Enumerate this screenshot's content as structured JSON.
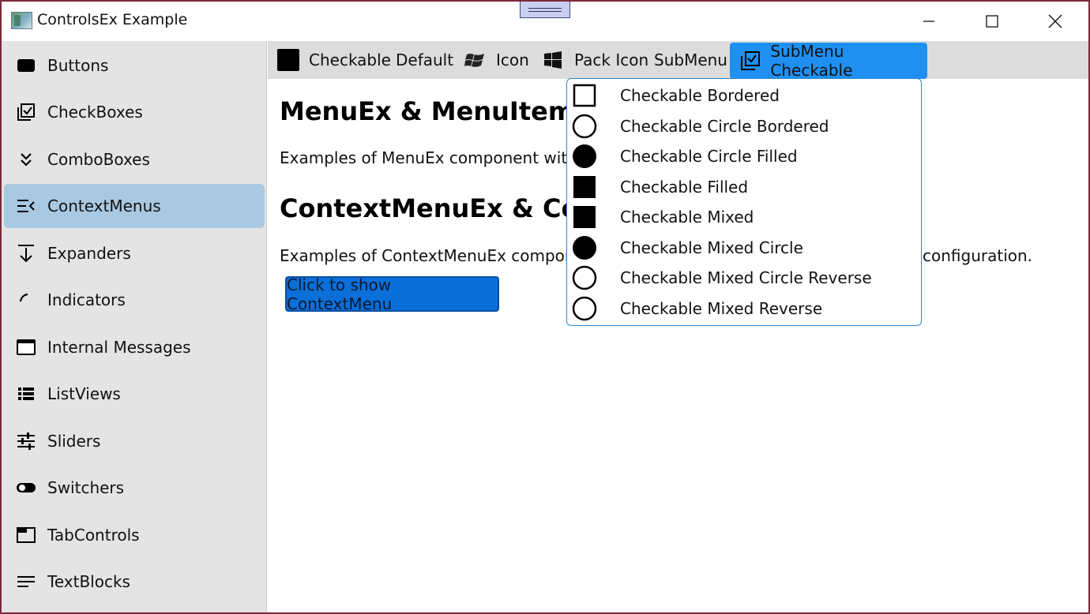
{
  "window": {
    "title": "ControlsEx Example",
    "accent": "#1f90f2",
    "border_color": "#7a2a3c"
  },
  "sidebar": {
    "items": [
      {
        "label": "Buttons",
        "icon": "button-icon"
      },
      {
        "label": "CheckBoxes",
        "icon": "checkboxes-icon"
      },
      {
        "label": "ComboBoxes",
        "icon": "chevrons-down-icon"
      },
      {
        "label": "ContextMenus",
        "icon": "context-menu-icon",
        "selected": true
      },
      {
        "label": "Expanders",
        "icon": "expander-icon"
      },
      {
        "label": "Indicators",
        "icon": "indicator-arc-icon"
      },
      {
        "label": "Internal Messages",
        "icon": "message-window-icon"
      },
      {
        "label": "ListViews",
        "icon": "list-view-icon"
      },
      {
        "label": "Sliders",
        "icon": "sliders-icon"
      },
      {
        "label": "Switchers",
        "icon": "toggle-icon"
      },
      {
        "label": "TabControls",
        "icon": "tab-icon"
      },
      {
        "label": "TextBlocks",
        "icon": "text-lines-icon"
      }
    ],
    "selected_color": "#a9c8e1"
  },
  "menubar": {
    "checkable": "Checkable",
    "default": "Default",
    "icon": "Icon",
    "pack_icon": "Pack Icon",
    "submenu": "SubMenu",
    "submenu_checkable": "SubMenu Checkable"
  },
  "content": {
    "heading1": "MenuEx & MenuItemEx",
    "para1": "Examples of MenuEx component with d",
    "heading2": "ContextMenuEx & Con",
    "para2_start": "Examples of ContextMenuEx componen",
    "para2_end": "configuration.",
    "button_label": "Click to show ContextMenu"
  },
  "dropdown": {
    "items": [
      {
        "label": "Checkable Bordered",
        "icon": "square-outline-icon"
      },
      {
        "label": "Checkable Circle Bordered",
        "icon": "circle-outline-icon"
      },
      {
        "label": "Checkable Circle Filled",
        "icon": "circle-filled-icon"
      },
      {
        "label": "Checkable Filled",
        "icon": "square-filled-icon"
      },
      {
        "label": "Checkable Mixed",
        "icon": "square-filled-icon"
      },
      {
        "label": "Checkable Mixed Circle",
        "icon": "circle-filled-icon"
      },
      {
        "label": "Checkable Mixed Circle Reverse",
        "icon": "circle-outline-icon"
      },
      {
        "label": "Checkable Mixed Reverse",
        "icon": "circle-outline-icon"
      }
    ]
  }
}
